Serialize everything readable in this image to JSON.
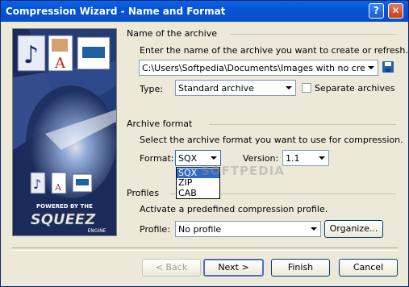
{
  "window": {
    "title": "Compression Wizard - Name and Format"
  },
  "sidebar": {
    "powered_by": "POWERED BY THE",
    "brand": "SQUEEZ",
    "engine": "ENGINE"
  },
  "name_section": {
    "heading": "Name of the archive",
    "instruction": "Enter the name of the archive you want to create or refresh.",
    "path_value": "C:\\Users\\Softpedia\\Documents\\Images with no creation c",
    "type_label": "Type:",
    "type_value": "Standard archive",
    "separate_label": "Separate archives"
  },
  "format_section": {
    "heading": "Archive format",
    "instruction": "Select the archive format you want to use for compression.",
    "format_label": "Format:",
    "format_value": "SQX",
    "version_label": "Version:",
    "version_value": "1.1",
    "format_options": [
      "SQX",
      "ZIP",
      "CAB"
    ]
  },
  "profiles_section": {
    "heading": "Profiles",
    "instruction": "Activate a predefined compression profile.",
    "profile_label": "Profile:",
    "profile_value": "No profile",
    "organize_label": "Organize..."
  },
  "buttons": {
    "back": "< Back",
    "next": "Next >",
    "finish": "Finish",
    "cancel": "Cancel"
  },
  "watermark": "SOFTPEDIA"
}
